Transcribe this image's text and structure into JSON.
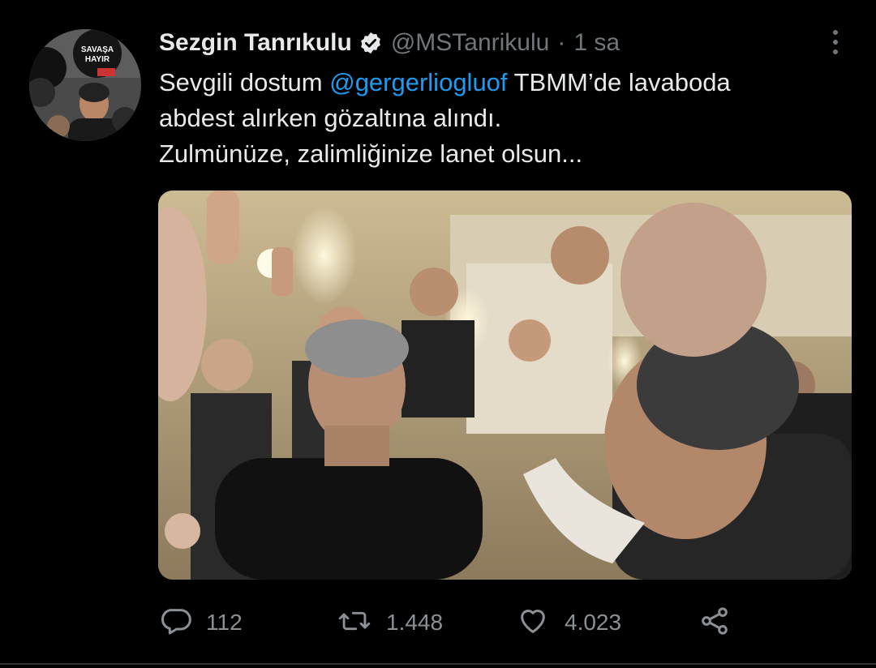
{
  "tweet": {
    "author": {
      "display_name": "Sezgin Tanrıkulu",
      "handle": "@MSTanrikulu",
      "verified": true,
      "avatar_sign_text": "SAVAŞA HAYIR"
    },
    "time_separator": "·",
    "time": "1 sa",
    "text": {
      "line1_before": "Sevgili dostum ",
      "mention": "@gergerliogluof",
      "line1_after": "  TBMM’de lavaboda",
      "line2": "abdest alırken gözaltına alındı.",
      "line3": "Zulmünüze, zalimliğinize lanet olsun..."
    },
    "counts": {
      "replies": "112",
      "retweets": "1.448",
      "likes": "4.023"
    }
  },
  "colors": {
    "background": "#000000",
    "text": "#e7e9ea",
    "muted": "#71767b",
    "link": "#1d9bf0"
  },
  "icons": [
    "verified-icon",
    "more-icon",
    "reply-icon",
    "retweet-icon",
    "like-icon",
    "share-icon"
  ]
}
